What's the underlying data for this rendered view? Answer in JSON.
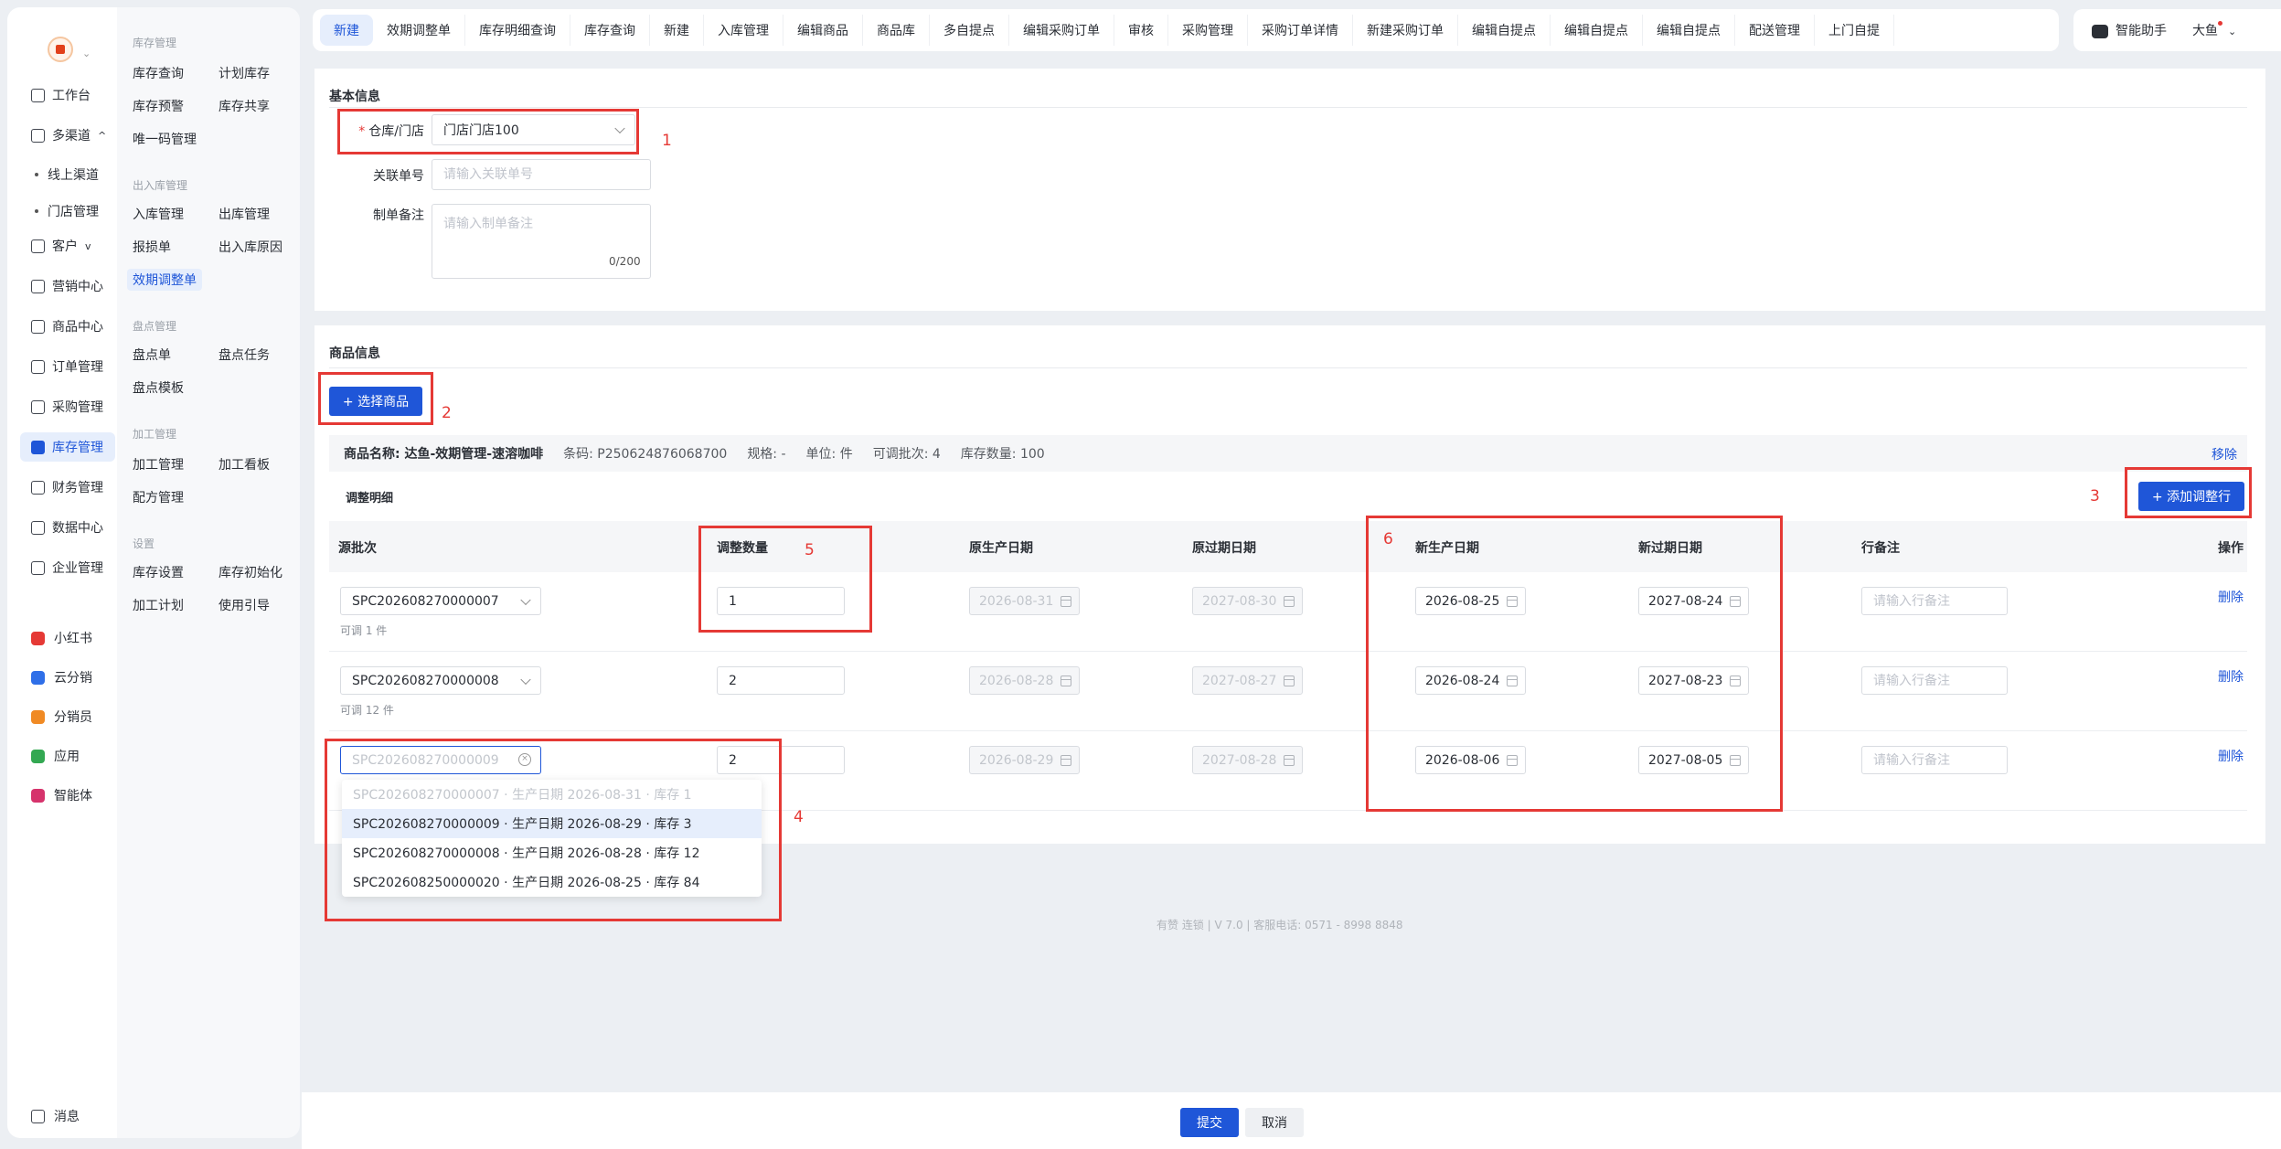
{
  "nav1": {
    "items": [
      {
        "label": "工作台",
        "icon": "workbench-icon"
      },
      {
        "label": "多渠道",
        "icon": "channel-icon",
        "chevron": "^"
      },
      {
        "label": "客户",
        "icon": "customer-icon",
        "chevron": "v"
      },
      {
        "label": "营销中心",
        "icon": "marketing-icon"
      },
      {
        "label": "商品中心",
        "icon": "product-icon"
      },
      {
        "label": "订单管理",
        "icon": "order-icon"
      },
      {
        "label": "采购管理",
        "icon": "cart-icon"
      },
      {
        "label": "库存管理",
        "icon": "warehouse-icon",
        "active": true
      },
      {
        "label": "财务管理",
        "icon": "finance-icon"
      },
      {
        "label": "数据中心",
        "icon": "chart-icon"
      },
      {
        "label": "企业管理",
        "icon": "company-icon"
      }
    ],
    "subitems": [
      "线上渠道",
      "门店管理"
    ],
    "apps": [
      {
        "label": "小红书",
        "color": "#e53935"
      },
      {
        "label": "云分销",
        "color": "#2f6fe8"
      },
      {
        "label": "分销员",
        "color": "#f08a24"
      },
      {
        "label": "应用",
        "color": "#33a852"
      },
      {
        "label": "智能体",
        "color": "#d6336c"
      }
    ],
    "message": "消息"
  },
  "nav2": {
    "groups": [
      {
        "title": "库存管理",
        "links": [
          "库存查询",
          "计划库存",
          "库存预警",
          "库存共享",
          "唯一码管理"
        ]
      },
      {
        "title": "出入库管理",
        "links": [
          "入库管理",
          "出库管理",
          "报损单",
          "出入库原因",
          "效期调整单"
        ]
      },
      {
        "title": "盘点管理",
        "links": [
          "盘点单",
          "盘点任务",
          "盘点模板"
        ]
      },
      {
        "title": "加工管理",
        "links": [
          "加工管理",
          "加工看板",
          "配方管理"
        ]
      },
      {
        "title": "设置",
        "links": [
          "库存设置",
          "库存初始化",
          "加工计划",
          "使用引导"
        ]
      }
    ]
  },
  "tabs": [
    "新建",
    "效期调整单",
    "库存明细查询",
    "库存查询",
    "新建",
    "入库管理",
    "编辑商品",
    "商品库",
    "多自提点",
    "编辑采购订单",
    "审核",
    "采购管理",
    "采购订单详情",
    "新建采购订单",
    "编辑自提点",
    "编辑自提点",
    "编辑自提点",
    "配送管理",
    "上门自提"
  ],
  "userbar": {
    "assistant": "智能助手",
    "user": "大鱼"
  },
  "basic": {
    "title": "基本信息",
    "warehouse_label": "仓库/门店",
    "warehouse_value": "门店门店100",
    "ref_label": "关联单号",
    "ref_placeholder": "请输入关联单号",
    "note_label": "制单备注",
    "note_placeholder": "请输入制单备注",
    "note_counter": "0/200"
  },
  "goods": {
    "title": "商品信息",
    "select_button": "+ 选择商品",
    "product": {
      "name": "商品名称: 达鱼-效期管理-速溶咖啡",
      "barcode": "条码: P250624876068700",
      "spec": "规格: -",
      "unit": "单位: 件",
      "batches": "可调批次: 4",
      "stock": "库存数量: 100"
    },
    "remove": "移除",
    "detail_title": "调整明细",
    "add_row": "+ 添加调整行",
    "columns": [
      "源批次",
      "调整数量",
      "原生产日期",
      "原过期日期",
      "新生产日期",
      "新过期日期",
      "行备注",
      "操作"
    ],
    "rows": [
      {
        "batch": "SPC202608270000007",
        "hint": "可调 1 件",
        "qty": "1",
        "orig_prod": "2026-08-31",
        "orig_exp": "2027-08-30",
        "new_prod": "2026-08-25",
        "new_exp": "2027-08-24",
        "note_placeholder": "请输入行备注",
        "action": "删除"
      },
      {
        "batch": "SPC202608270000008",
        "hint": "可调 12 件",
        "qty": "2",
        "orig_prod": "2026-08-28",
        "orig_exp": "2027-08-27",
        "new_prod": "2026-08-24",
        "new_exp": "2027-08-23",
        "note_placeholder": "请输入行备注",
        "action": "删除"
      },
      {
        "batch": "SPC202608270000009",
        "hint": "",
        "qty": "2",
        "orig_prod": "2026-08-29",
        "orig_exp": "2027-08-28",
        "new_prod": "2026-08-06",
        "new_exp": "2027-08-05",
        "note_placeholder": "请输入行备注",
        "action": "删除"
      }
    ],
    "dropdown": [
      "SPC202608270000007 · 生产日期 2026-08-31 · 库存 1",
      "SPC202608270000009 · 生产日期 2026-08-29 · 库存 3",
      "SPC202608270000008 · 生产日期 2026-08-28 · 库存 12",
      "SPC202608250000020 · 生产日期 2026-08-25 · 库存 84"
    ]
  },
  "annotations": [
    "1",
    "2",
    "3",
    "4",
    "5",
    "6"
  ],
  "copyright": "有赞 连锁 | V 7.0 | 客服电话: 0571 - 8998 8848",
  "footer": {
    "submit": "提交",
    "cancel": "取消"
  },
  "colors": {
    "primary": "#1f56d8",
    "annotation": "#e53935"
  }
}
